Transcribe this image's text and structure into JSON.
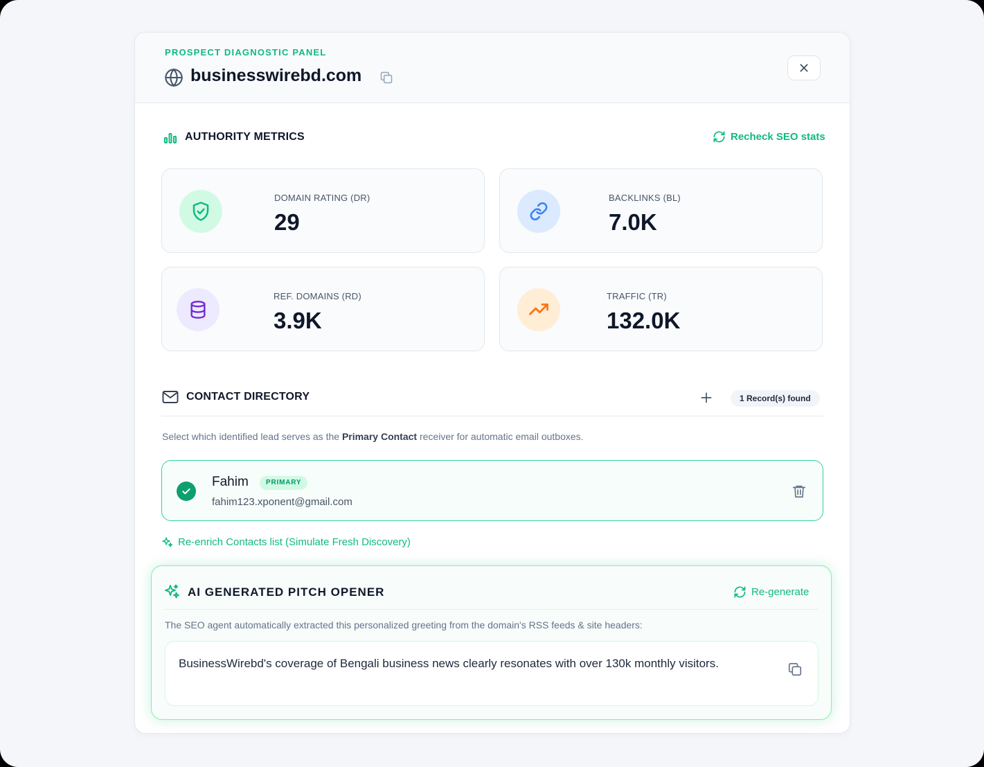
{
  "header": {
    "eyebrow": "PROSPECT DIAGNOSTIC PANEL",
    "domain": "businesswirebd.com"
  },
  "authority": {
    "title": "AUTHORITY METRICS",
    "recheck_label": "Recheck SEO stats",
    "metrics": [
      {
        "label": "DOMAIN RATING (DR)",
        "value": "29",
        "icon": "shield-check-icon",
        "color": "#10b981"
      },
      {
        "label": "BACKLINKS (BL)",
        "value": "7.0K",
        "icon": "link-icon",
        "color": "#3b82f6"
      },
      {
        "label": "REF. DOMAINS (RD)",
        "value": "3.9K",
        "icon": "database-icon",
        "color": "#6d28d9"
      },
      {
        "label": "TRAFFIC (TR)",
        "value": "132.0K",
        "icon": "trending-up-icon",
        "color": "#f97316"
      }
    ]
  },
  "contacts": {
    "title": "CONTACT DIRECTORY",
    "record_count": "1 Record(s) found",
    "helper_prefix": "Select which identified lead serves as the ",
    "helper_bold": "Primary Contact",
    "helper_suffix": " receiver for automatic email outboxes.",
    "items": [
      {
        "name": "Fahim",
        "badge": "PRIMARY",
        "email": "fahim123.xponent@gmail.com"
      }
    ],
    "reenrich_label": "Re-enrich Contacts list (Simulate Fresh Discovery)"
  },
  "pitch": {
    "title": "AI GENERATED PITCH OPENER",
    "regenerate_label": "Re-generate",
    "description": "The SEO agent automatically extracted this personalized greeting from the domain's RSS feeds & site headers:",
    "text": "BusinessWirebd's coverage of Bengali business news clearly resonates with over 130k monthly visitors."
  },
  "colors": {
    "accent": "#10b981",
    "text_dark": "#0f172a",
    "text_muted": "#64748b"
  }
}
